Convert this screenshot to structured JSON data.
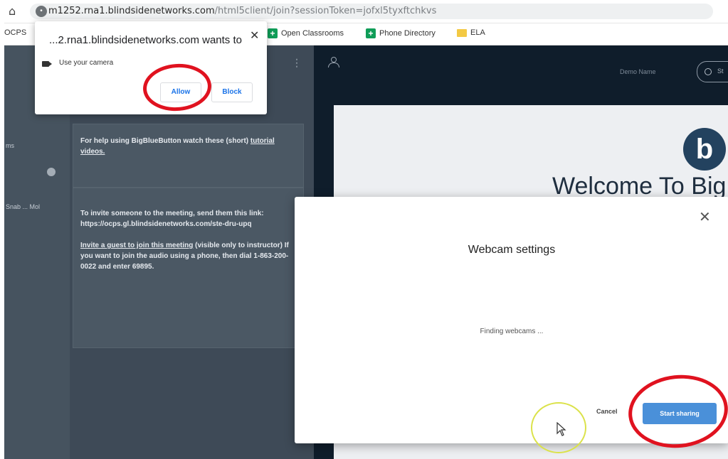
{
  "browser": {
    "url_host": "m1252.rna1.blindsidenetworks.com",
    "url_path": "/html5client/join?sessionToken=jofxl5tyxftchkvs"
  },
  "bookmarks": {
    "left_cut": "OCPS",
    "items": [
      {
        "label": "Open Classrooms",
        "icon": "google-classroom-icon"
      },
      {
        "label": "Phone Directory",
        "icon": "google-classroom-icon"
      },
      {
        "label": "ELA",
        "icon": "folder-icon"
      }
    ]
  },
  "permission_popup": {
    "title": "...2.rna1.blindsidenetworks.com wants to",
    "request": "Use your camera",
    "allow": "Allow",
    "block": "Block",
    "close": "✕"
  },
  "chat": {
    "sidebar": {
      "item1": "ms",
      "item2": "Snab ... Mol"
    },
    "message1": {
      "line1": "For help using BigBlueButton watch these (short)",
      "link": "tutorial videos."
    },
    "message2": {
      "line1": "To invite someone to the meeting, send them this link:",
      "link": "https://ocps.gl.blindsidenetworks.com/ste-dru-upq",
      "guest_link": "Invite a guest to join this meeting",
      "guest_text": " (visible only to instructor) If you want to join the audio using a phone, then dial 1-863-200-0022 and enter 69895."
    }
  },
  "meeting": {
    "presenter_name": "Demo Name",
    "record_label": "St",
    "welcome": "Welcome To Big",
    "logo_glyph": "b"
  },
  "webcam_modal": {
    "title": "Webcam settings",
    "status": "Finding webcams ...",
    "cancel": "Cancel",
    "start": "Start sharing",
    "close": "✕"
  },
  "colors": {
    "annotation_red": "#e0121f",
    "annotation_yellow": "#dbe24a",
    "primary_button": "#4a90d9"
  }
}
